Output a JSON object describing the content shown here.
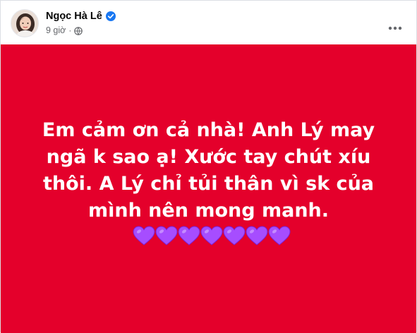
{
  "post": {
    "author_name": "Ngọc Hà Lê",
    "timestamp": "9 giờ",
    "separator": "·",
    "status_text": "Em cảm ơn cả nhà! Anh Lý may ngã k sao ạ! Xước tay chút xíu thôi. A Lý chỉ tủi thân vì sk của mình nên mong manh.",
    "emoji_count": 7,
    "emoji": "purple-heart",
    "colors": {
      "card_background": "#e4002b",
      "text": "#ffffff",
      "heart": "#a64dff",
      "verified": "#1877f2"
    },
    "icons": {
      "verified": "verified-badge-icon",
      "audience": "globe-icon",
      "menu": "more-options-icon"
    }
  }
}
